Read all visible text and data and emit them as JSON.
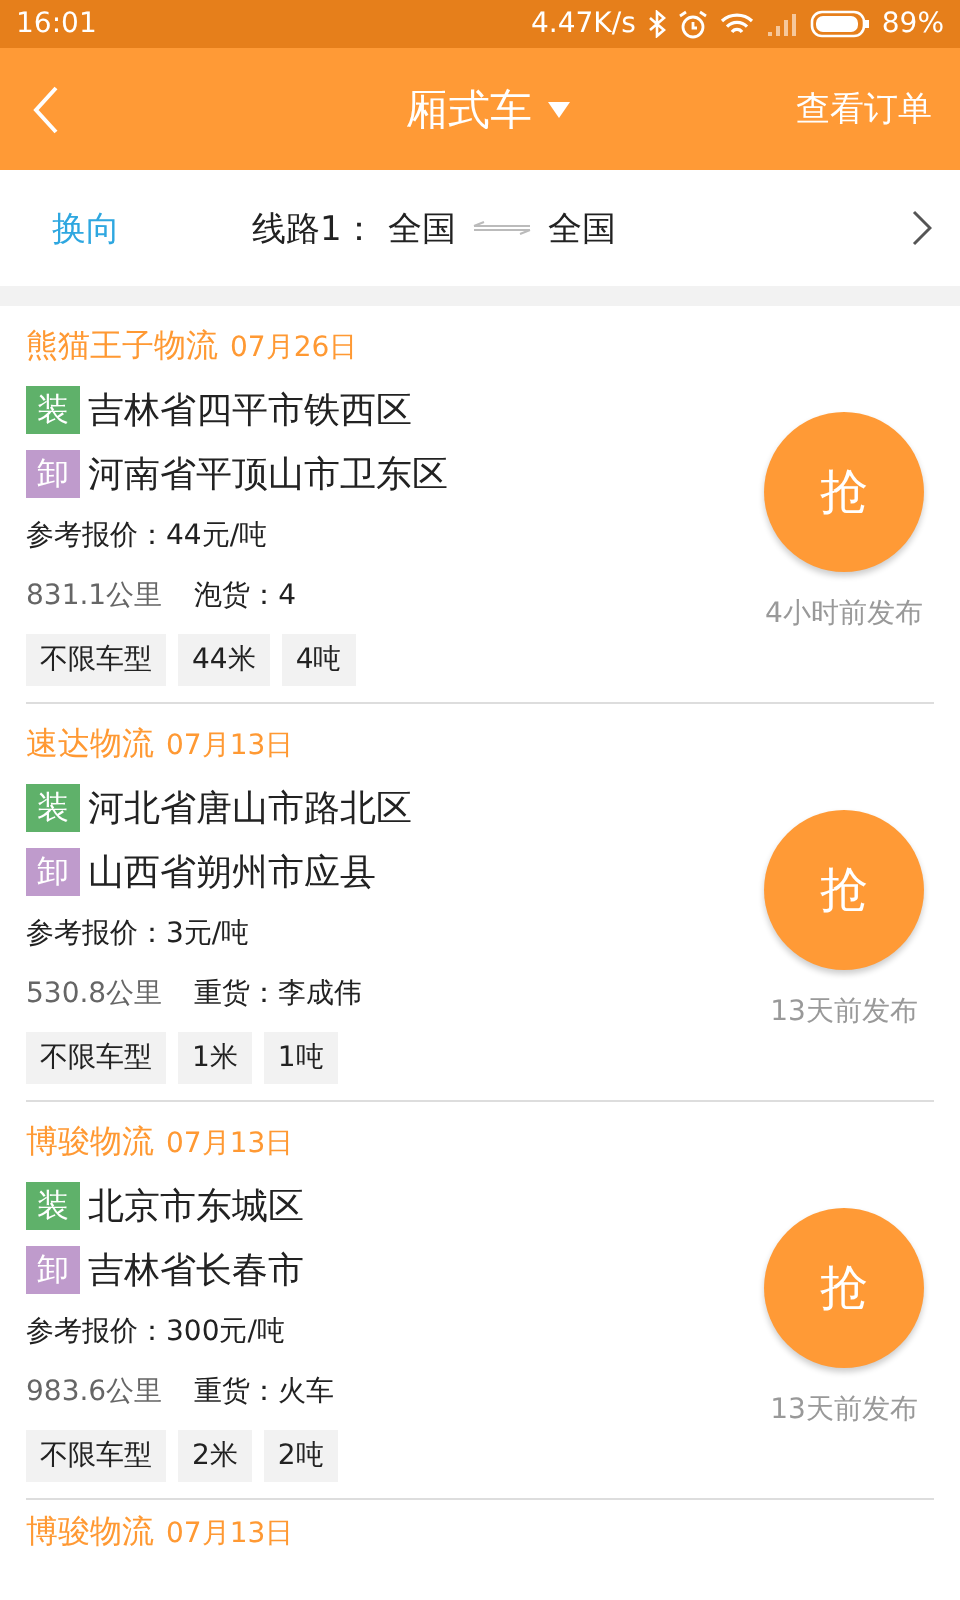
{
  "status_bar": {
    "time": "16:01",
    "net_speed": "4.47K/s",
    "battery": "89%"
  },
  "header": {
    "title": "厢式车",
    "action": "查看订单"
  },
  "route": {
    "swap": "换向",
    "label": "线路1：",
    "from": "全国",
    "to": "全国"
  },
  "orders": [
    {
      "company": "熊猫王子物流",
      "date": "07月26日",
      "load_badge": "装",
      "load": "吉林省四平市铁西区",
      "unload_badge": "卸",
      "unload": "河南省平顶山市卫东区",
      "price": "参考报价：44元/吨",
      "distance": "831.1公里",
      "cargo": "泡货：4",
      "tags": [
        "不限车型",
        "44米",
        "4吨"
      ],
      "grab": "抢",
      "posted": "4小时前发布"
    },
    {
      "company": "速达物流",
      "date": "07月13日",
      "load_badge": "装",
      "load": "河北省唐山市路北区",
      "unload_badge": "卸",
      "unload": "山西省朔州市应县",
      "price": "参考报价：3元/吨",
      "distance": "530.8公里",
      "cargo": "重货：李成伟",
      "tags": [
        "不限车型",
        "1米",
        "1吨"
      ],
      "grab": "抢",
      "posted": "13天前发布"
    },
    {
      "company": "博骏物流",
      "date": "07月13日",
      "load_badge": "装",
      "load": "北京市东城区",
      "unload_badge": "卸",
      "unload": "吉林省长春市",
      "price": "参考报价：300元/吨",
      "distance": "983.6公里",
      "cargo": "重货：火车",
      "tags": [
        "不限车型",
        "2米",
        "2吨"
      ],
      "grab": "抢",
      "posted": "13天前发布"
    }
  ],
  "partial_order": {
    "company": "博骏物流",
    "date": "07月13日"
  }
}
